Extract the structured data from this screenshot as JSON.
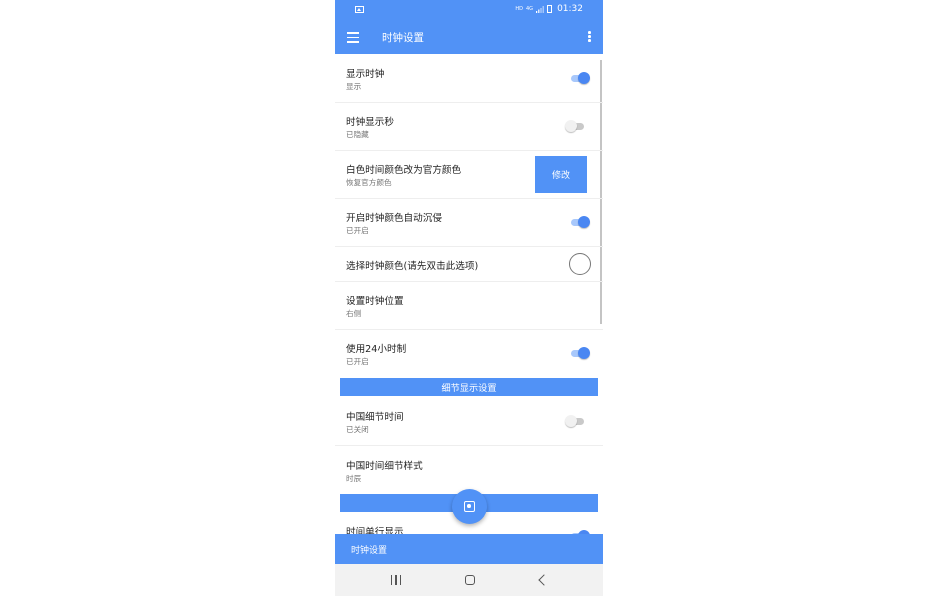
{
  "statusbar": {
    "network": "HD",
    "signal_label": "4G",
    "time": "01:32"
  },
  "appbar": {
    "title": "时钟设置"
  },
  "settings": [
    {
      "title": "显示时钟",
      "subtitle": "显示",
      "toggle": "on"
    },
    {
      "title": "时钟显示秒",
      "subtitle": "已隐藏",
      "toggle": "off"
    },
    {
      "title": "白色时间颜色改为官方颜色",
      "subtitle": "恢复官方颜色",
      "button": "修改"
    },
    {
      "title": "开启时钟颜色自动沉侵",
      "subtitle": "已开启",
      "toggle": "on"
    },
    {
      "title": "选择时钟颜色(请先双击此选项)"
    },
    {
      "title": "设置时钟位置",
      "subtitle": "右侧"
    },
    {
      "title": "使用24小时制",
      "subtitle": "已开启",
      "toggle": "on"
    }
  ],
  "section_detail": {
    "title": "细节显示设置"
  },
  "detail_settings": [
    {
      "title": "中国细节时间",
      "subtitle": "已关闭",
      "toggle": "off"
    },
    {
      "title": "中国时间细节样式",
      "subtitle": "时辰"
    }
  ],
  "partial_item": {
    "title": "时间单行显示"
  },
  "bottom_tab": {
    "label": "时钟设置"
  },
  "colors": {
    "accent": "#5192f6",
    "toggle_on": "#4a87f2"
  }
}
